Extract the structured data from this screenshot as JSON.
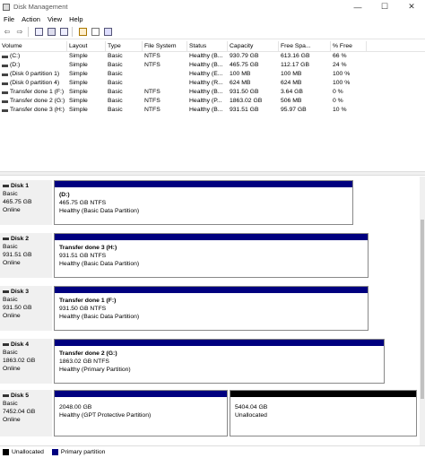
{
  "window": {
    "title": "Disk Management",
    "minimize": "—",
    "maximize": "☐",
    "close": "✕"
  },
  "menu": [
    "File",
    "Action",
    "View",
    "Help"
  ],
  "toolbar": {
    "back": "⇦",
    "forward": "⇨"
  },
  "volume_table": {
    "columns": [
      "Volume",
      "Layout",
      "Type",
      "File System",
      "Status",
      "Capacity",
      "Free Spa...",
      "% Free"
    ],
    "rows": [
      [
        "(C:)",
        "Simple",
        "Basic",
        "NTFS",
        "Healthy (B...",
        "930.79 GB",
        "613.16 GB",
        "66 %"
      ],
      [
        "(D:)",
        "Simple",
        "Basic",
        "NTFS",
        "Healthy (B...",
        "465.75 GB",
        "112.17 GB",
        "24 %"
      ],
      [
        "(Disk 0 partition 1)",
        "Simple",
        "Basic",
        "",
        "Healthy (E...",
        "100 MB",
        "100 MB",
        "100 %"
      ],
      [
        "(Disk 0 partition 4)",
        "Simple",
        "Basic",
        "",
        "Healthy (R...",
        "624 MB",
        "624 MB",
        "100 %"
      ],
      [
        "Transfer done 1 (F:)",
        "Simple",
        "Basic",
        "NTFS",
        "Healthy (B...",
        "931.50 GB",
        "3.64 GB",
        "0 %"
      ],
      [
        "Transfer done 2 (G:)",
        "Simple",
        "Basic",
        "NTFS",
        "Healthy (P...",
        "1863.02 GB",
        "506 MB",
        "0 %"
      ],
      [
        "Transfer done 3 (H:)",
        "Simple",
        "Basic",
        "NTFS",
        "Healthy (B...",
        "931.51 GB",
        "95.97 GB",
        "10 %"
      ]
    ]
  },
  "disks": [
    {
      "name": "Disk 1",
      "type": "Basic",
      "size": "465.75 GB",
      "status": "Online",
      "partitions": [
        {
          "name": "(D:)",
          "size_fs": "465.75 GB NTFS",
          "status": "Healthy (Basic Data Partition)"
        }
      ]
    },
    {
      "name": "Disk 2",
      "type": "Basic",
      "size": "931.51 GB",
      "status": "Online",
      "partitions": [
        {
          "name": "Transfer done 3  (H:)",
          "size_fs": "931.51 GB NTFS",
          "status": "Healthy (Basic Data Partition)"
        }
      ]
    },
    {
      "name": "Disk 3",
      "type": "Basic",
      "size": "931.50 GB",
      "status": "Online",
      "partitions": [
        {
          "name": "Transfer done 1  (F:)",
          "size_fs": "931.50 GB NTFS",
          "status": "Healthy (Basic Data Partition)"
        }
      ]
    },
    {
      "name": "Disk 4",
      "type": "Basic",
      "size": "1863.02 GB",
      "status": "Online",
      "partitions": [
        {
          "name": "Transfer done 2  (G:)",
          "size_fs": "1863.02 GB NTFS",
          "status": "Healthy (Primary Partition)"
        }
      ]
    },
    {
      "name": "Disk 5",
      "type": "Basic",
      "size": "7452.04 GB",
      "status": "Online",
      "partitions": [
        {
          "name": "",
          "size_fs": "2048.00 GB",
          "status": "Healthy (GPT Protective Partition)"
        },
        {
          "name": "",
          "size_fs": "5404.04 GB",
          "status": "Unallocated"
        }
      ]
    }
  ],
  "legend": [
    {
      "label": "Unallocated",
      "color": "#000000"
    },
    {
      "label": "Primary partition",
      "color": "#00007f"
    }
  ]
}
